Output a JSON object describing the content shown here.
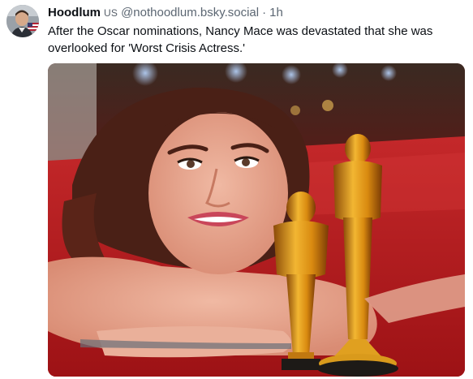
{
  "post": {
    "author": {
      "display_name": "Hoodlum",
      "flag": "US",
      "handle": "@nothoodlum.bsky.social",
      "separator": "·",
      "timestamp": "1h"
    },
    "text": "After the Oscar nominations, Nancy Mace was devastated that she was overlooked for 'Worst Crisis Actress.'",
    "media": {
      "kind": "photo",
      "subject": "crying woman lying on red carpet beside two golden statuettes"
    },
    "icons": {
      "avatar": "user-avatar"
    },
    "colors": {
      "text": "#0f1419",
      "muted": "#5b6672",
      "carpet": "#b0181a",
      "gold": "#e0a020"
    }
  }
}
